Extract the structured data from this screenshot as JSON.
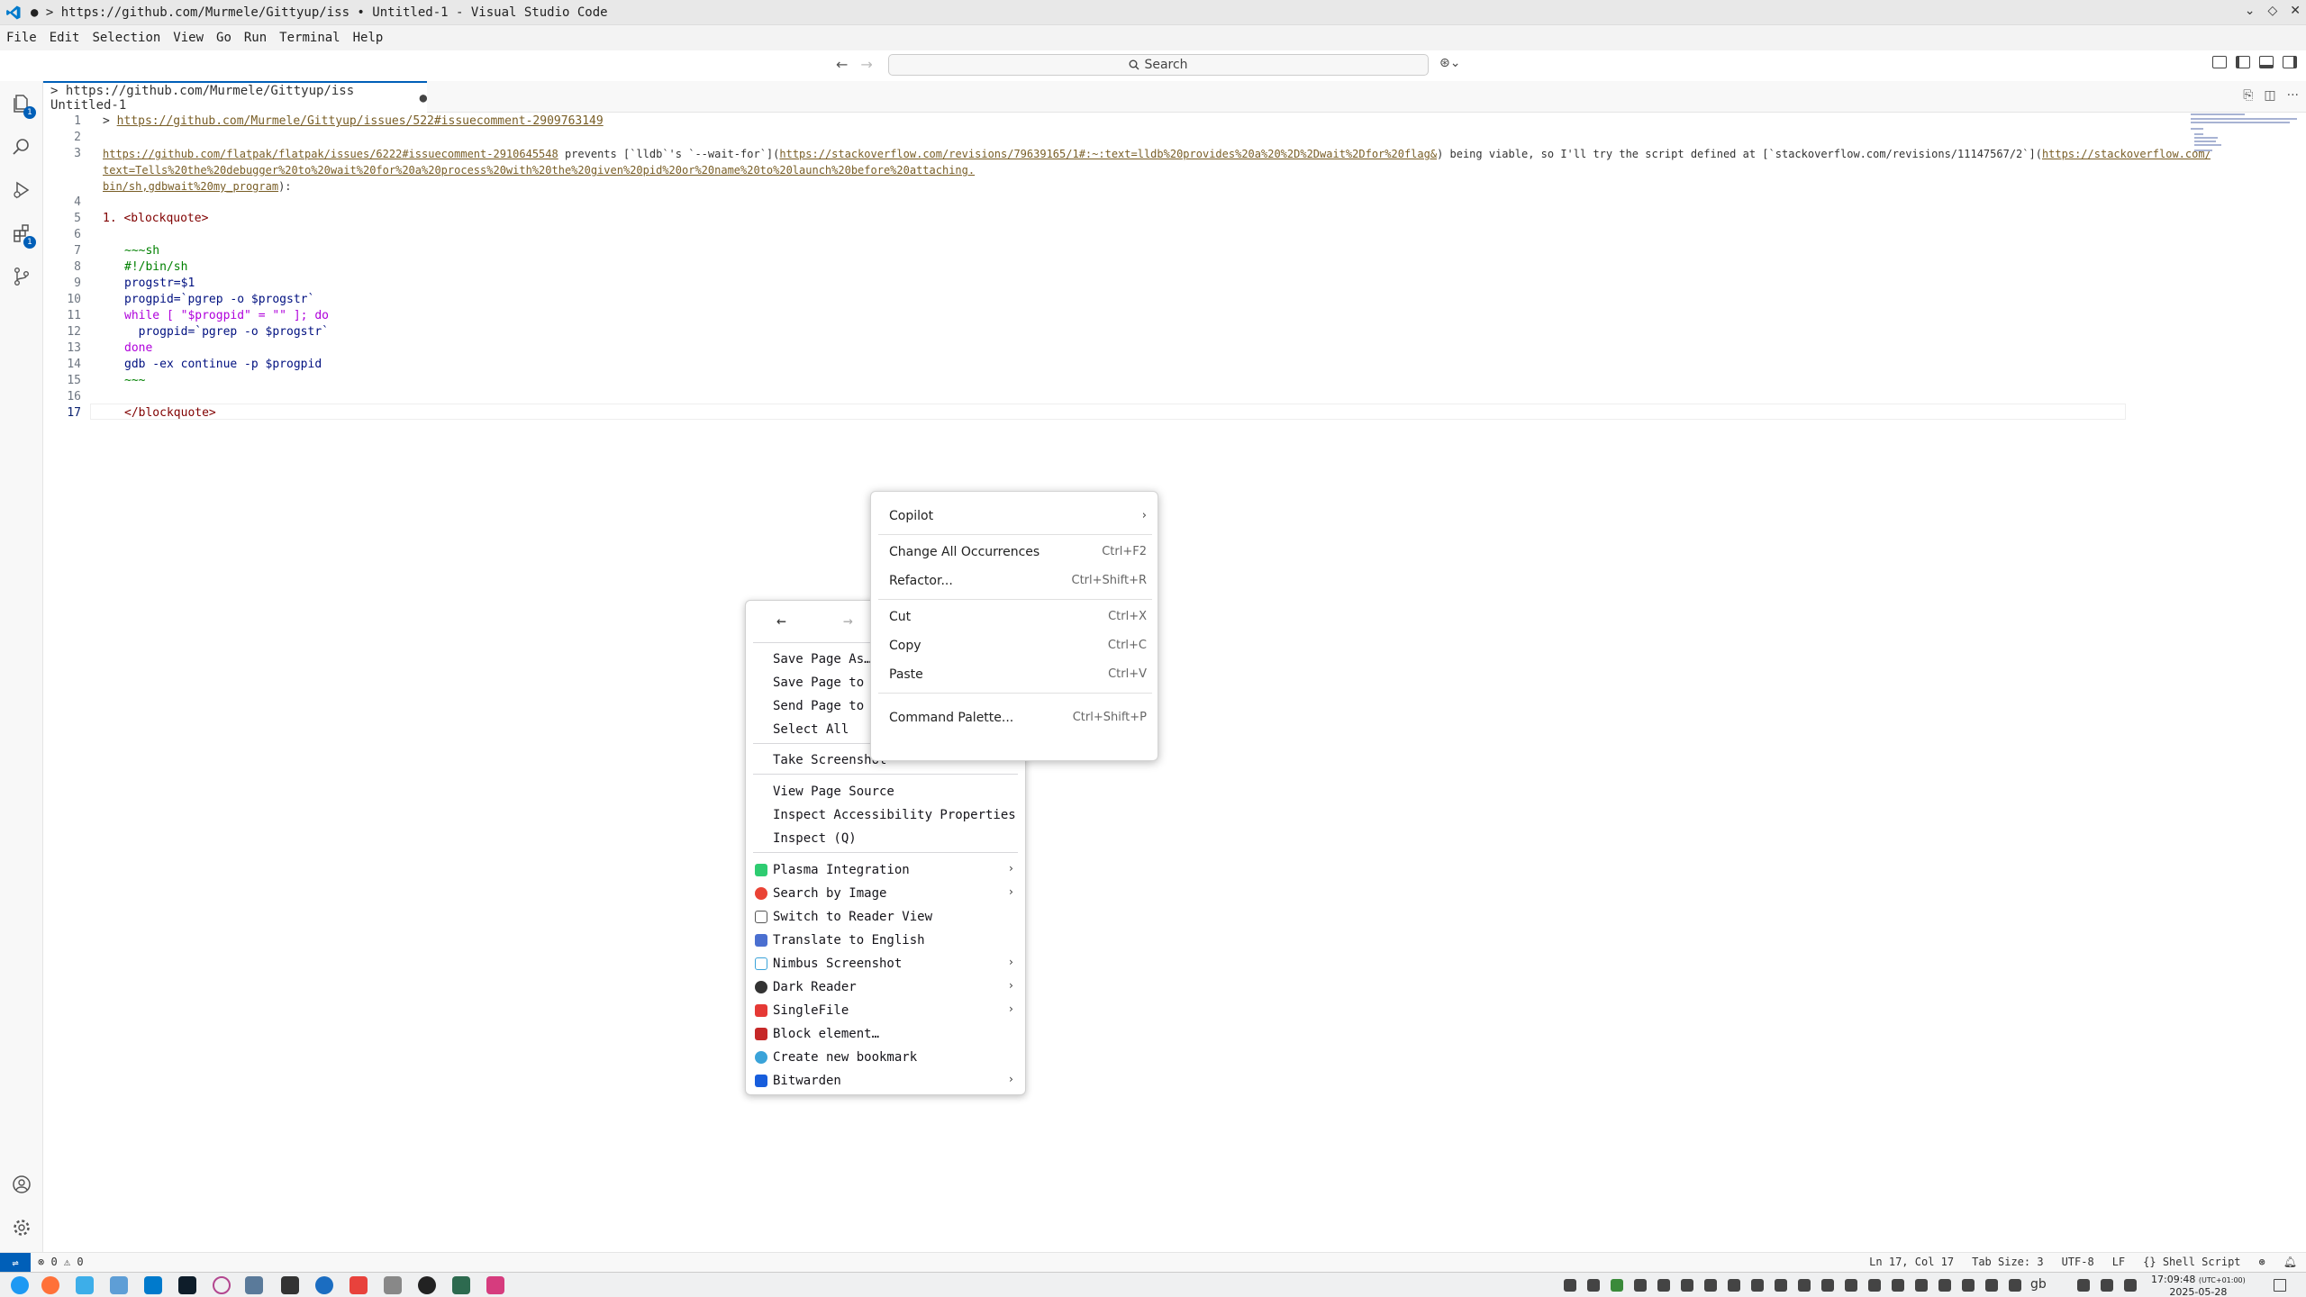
{
  "window": {
    "title": "● > https://github.com/Murmele/Gittyup/iss • Untitled-1 - Visual Studio Code",
    "controls": [
      "⌄",
      "◇",
      "✕"
    ]
  },
  "menubar": [
    "File",
    "Edit",
    "Selection",
    "View",
    "Go",
    "Run",
    "Terminal",
    "Help"
  ],
  "command_center": {
    "search_label": "Search",
    "back": "←",
    "forward": "→",
    "copilot": "⊛⌄"
  },
  "activity_bar": {
    "explorer_badge": "1",
    "extensions_badge": "1"
  },
  "tab": {
    "label": "> https://github.com/Murmele/Gittyup/iss Untitled-1",
    "dirty": "●",
    "actions": [
      "⎘",
      "◫",
      "···"
    ]
  },
  "editor": {
    "lines": [
      {
        "n": "1",
        "t": "> ",
        "l": "https://github.com/Murmele/Gittyup/issues/522#issuecomment-2909763149"
      },
      {
        "n": "2",
        "t": ""
      },
      {
        "n": "3",
        "l": "https://github.com/flatpak/flatpak/issues/6222#issuecomment-2910645548",
        "t": " prevents [`lldb`'s `--wait-for`](",
        "l2": "https://stackoverflow.com/revisions/79639165/1#:~:text=lldb%20provides%20a%20%2D%2Dwait%2Dfor%20flag&",
        "t2": ") being viable, so I'll try the script defined at [`stackoverflow.com/revisions/11147567/2`](",
        "l3": "https://stackoverflow.com/revisions/11147567/2#content:~:text=%23!/"
      },
      {
        "n": "",
        "l": "text=Tells%20the%20debugger%20to%20wait%20for%20a%20process%20with%20the%20given%20pid%20or%20name%20to%20launch%20before%20attaching.",
        "t": ""
      },
      {
        "n": "",
        "l": "bin/sh,gdbwait%20my_program",
        "t": "):"
      },
      {
        "n": "4",
        "t": ""
      },
      {
        "n": "5",
        "t": "1. <blockquote>"
      },
      {
        "n": "6",
        "t": ""
      },
      {
        "n": "7",
        "t": "~~~sh"
      },
      {
        "n": "8",
        "t": "#!/bin/sh"
      },
      {
        "n": "9",
        "t": "progstr=$1"
      },
      {
        "n": "10",
        "t": "progpid=`pgrep -o $progstr`"
      },
      {
        "n": "11",
        "t": "while [ \"$progpid\" = \"\" ]; do"
      },
      {
        "n": "12",
        "t": "  progpid=`pgrep -o $progstr`"
      },
      {
        "n": "13",
        "t": "done"
      },
      {
        "n": "14",
        "t": "gdb -ex continue -p $progpid"
      },
      {
        "n": "15",
        "t": "~~~"
      },
      {
        "n": "16",
        "t": ""
      },
      {
        "n": "17",
        "t": "</blockquote>"
      }
    ]
  },
  "firefox_menu": {
    "back": "←",
    "forward": "→",
    "items": [
      "Save Page As…",
      "Save Page to P",
      "Send Page to D",
      "Select All",
      "Take Screenshot",
      "View Page Source",
      "Inspect Accessibility Properties",
      "Inspect (Q)",
      "Plasma Integration",
      "Search by Image",
      "Switch to Reader View",
      "Translate to English",
      "Nimbus Screenshot",
      "Dark Reader",
      "SingleFile",
      "Block element…",
      "Create new bookmark",
      "Bitwarden"
    ]
  },
  "vscode_menu": {
    "copilot": "Copilot",
    "items": [
      {
        "label": "Change All Occurrences",
        "kb": "Ctrl+F2"
      },
      {
        "label": "Refactor...",
        "kb": "Ctrl+Shift+R"
      },
      {
        "label": "Cut",
        "kb": "Ctrl+X"
      },
      {
        "label": "Copy",
        "kb": "Ctrl+C"
      },
      {
        "label": "Paste",
        "kb": "Ctrl+V"
      },
      {
        "label": "Command Palette...",
        "kb": "Ctrl+Shift+P"
      }
    ]
  },
  "statusbar": {
    "remote": "⇌",
    "problems": "⊗ 0 ⚠ 0",
    "position": "Ln 17, Col 17",
    "tab_size": "Tab Size: 3",
    "encoding": "UTF-8",
    "eol": "LF",
    "language": "{} Shell Script"
  },
  "taskbar": {
    "time": "17:09:48",
    "tz": "(UTC+01:00)",
    "date": "2025-05-28",
    "kb_layout": "gb"
  },
  "colors": {
    "accent": "#005fb8",
    "link": "#795e26",
    "tag": "#800000"
  }
}
